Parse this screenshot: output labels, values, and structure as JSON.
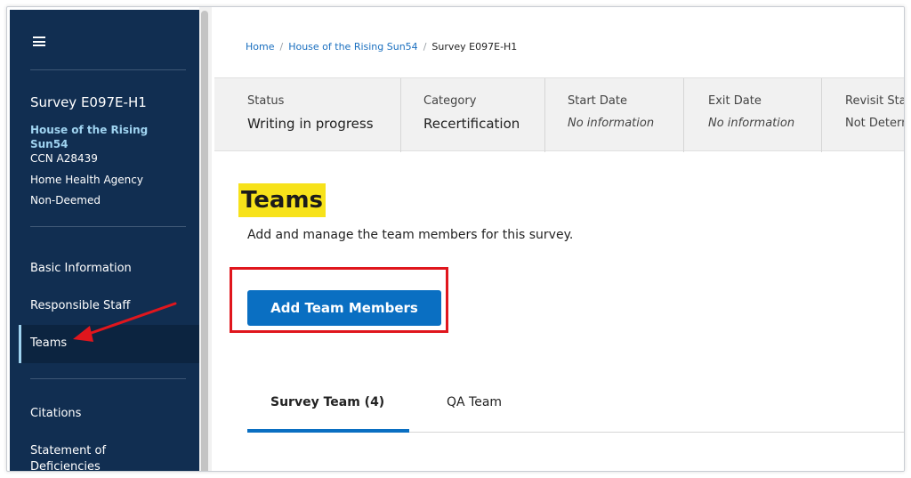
{
  "sidebar": {
    "survey_title": "Survey E097E-H1",
    "provider_name": "House of the Rising Sun54",
    "ccn": "CCN A28439",
    "provider_type": "Home Health Agency",
    "deemed_status": "Non-Deemed",
    "nav": {
      "basic_information": "Basic Information",
      "responsible_staff": "Responsible Staff",
      "teams": "Teams",
      "citations": "Citations",
      "statement_of_deficiencies": "Statement of Deficiencies"
    }
  },
  "breadcrumb": {
    "home": "Home",
    "provider": "House of the Rising Sun54",
    "current": "Survey E097E-H1",
    "separator": "/"
  },
  "status_bar": {
    "status": {
      "label": "Status",
      "value": "Writing in progress"
    },
    "category": {
      "label": "Category",
      "value": "Recertification"
    },
    "start_date": {
      "label": "Start Date",
      "value": "No information"
    },
    "exit_date": {
      "label": "Exit Date",
      "value": "No information"
    },
    "revisit_status": {
      "label": "Revisit Statu",
      "value": "Not Determ"
    }
  },
  "page": {
    "title": "Teams",
    "description": "Add and manage the team members for this survey.",
    "add_button_label": "Add Team Members"
  },
  "tabs": {
    "survey_team": "Survey Team (4)",
    "qa_team": "QA Team"
  },
  "colors": {
    "sidebar_bg": "#112e51",
    "accent_blue": "#0a6fc2",
    "highlight_yellow": "#f7e21a",
    "annotation_red": "#e0161d"
  },
  "icons": {
    "menu": "hamburger-menu-icon",
    "annotation": "red-arrow-icon"
  }
}
